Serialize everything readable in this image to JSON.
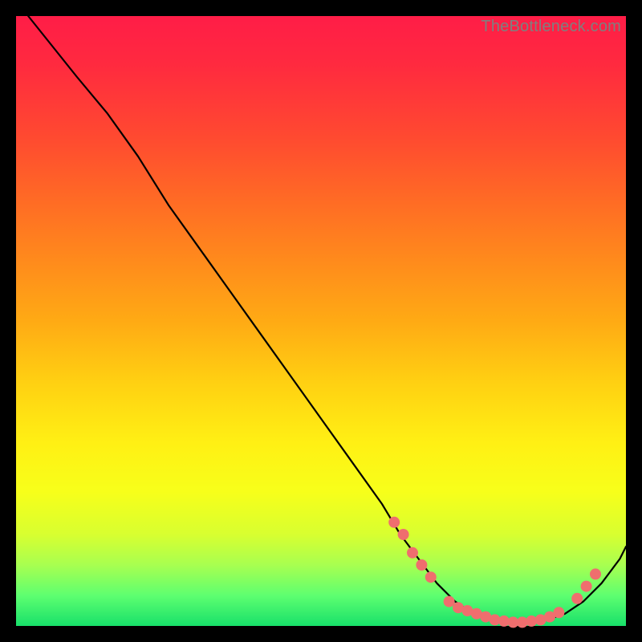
{
  "watermark": "TheBottleneck.com",
  "colors": {
    "dot": "#ef6e6e",
    "line": "#000000",
    "frame": "#000000"
  },
  "chart_data": {
    "type": "line",
    "title": "",
    "xlabel": "",
    "ylabel": "",
    "xlim": [
      0,
      100
    ],
    "ylim": [
      0,
      100
    ],
    "grid": false,
    "legend": false,
    "series": [
      {
        "name": "curve",
        "x": [
          2,
          6,
          10,
          15,
          20,
          25,
          30,
          35,
          40,
          45,
          50,
          55,
          60,
          63,
          66,
          69,
          72,
          75,
          78,
          81,
          84,
          87,
          90,
          93,
          96,
          99,
          100
        ],
        "y": [
          100,
          95,
          90,
          84,
          77,
          69,
          62,
          55,
          48,
          41,
          34,
          27,
          20,
          15,
          11,
          7,
          4,
          2,
          1,
          0.5,
          0.5,
          1,
          2,
          4,
          7,
          11,
          13
        ]
      }
    ],
    "markers": [
      {
        "x": 62,
        "y": 17
      },
      {
        "x": 63.5,
        "y": 15
      },
      {
        "x": 65,
        "y": 12
      },
      {
        "x": 66.5,
        "y": 10
      },
      {
        "x": 68,
        "y": 8
      },
      {
        "x": 71,
        "y": 4
      },
      {
        "x": 72.5,
        "y": 3
      },
      {
        "x": 74,
        "y": 2.5
      },
      {
        "x": 75.5,
        "y": 2
      },
      {
        "x": 77,
        "y": 1.5
      },
      {
        "x": 78.5,
        "y": 1
      },
      {
        "x": 80,
        "y": 0.8
      },
      {
        "x": 81.5,
        "y": 0.6
      },
      {
        "x": 83,
        "y": 0.6
      },
      {
        "x": 84.5,
        "y": 0.8
      },
      {
        "x": 86,
        "y": 1
      },
      {
        "x": 87.5,
        "y": 1.5
      },
      {
        "x": 89,
        "y": 2.2
      },
      {
        "x": 92,
        "y": 4.5
      },
      {
        "x": 93.5,
        "y": 6.5
      },
      {
        "x": 95,
        "y": 8.5
      }
    ]
  }
}
